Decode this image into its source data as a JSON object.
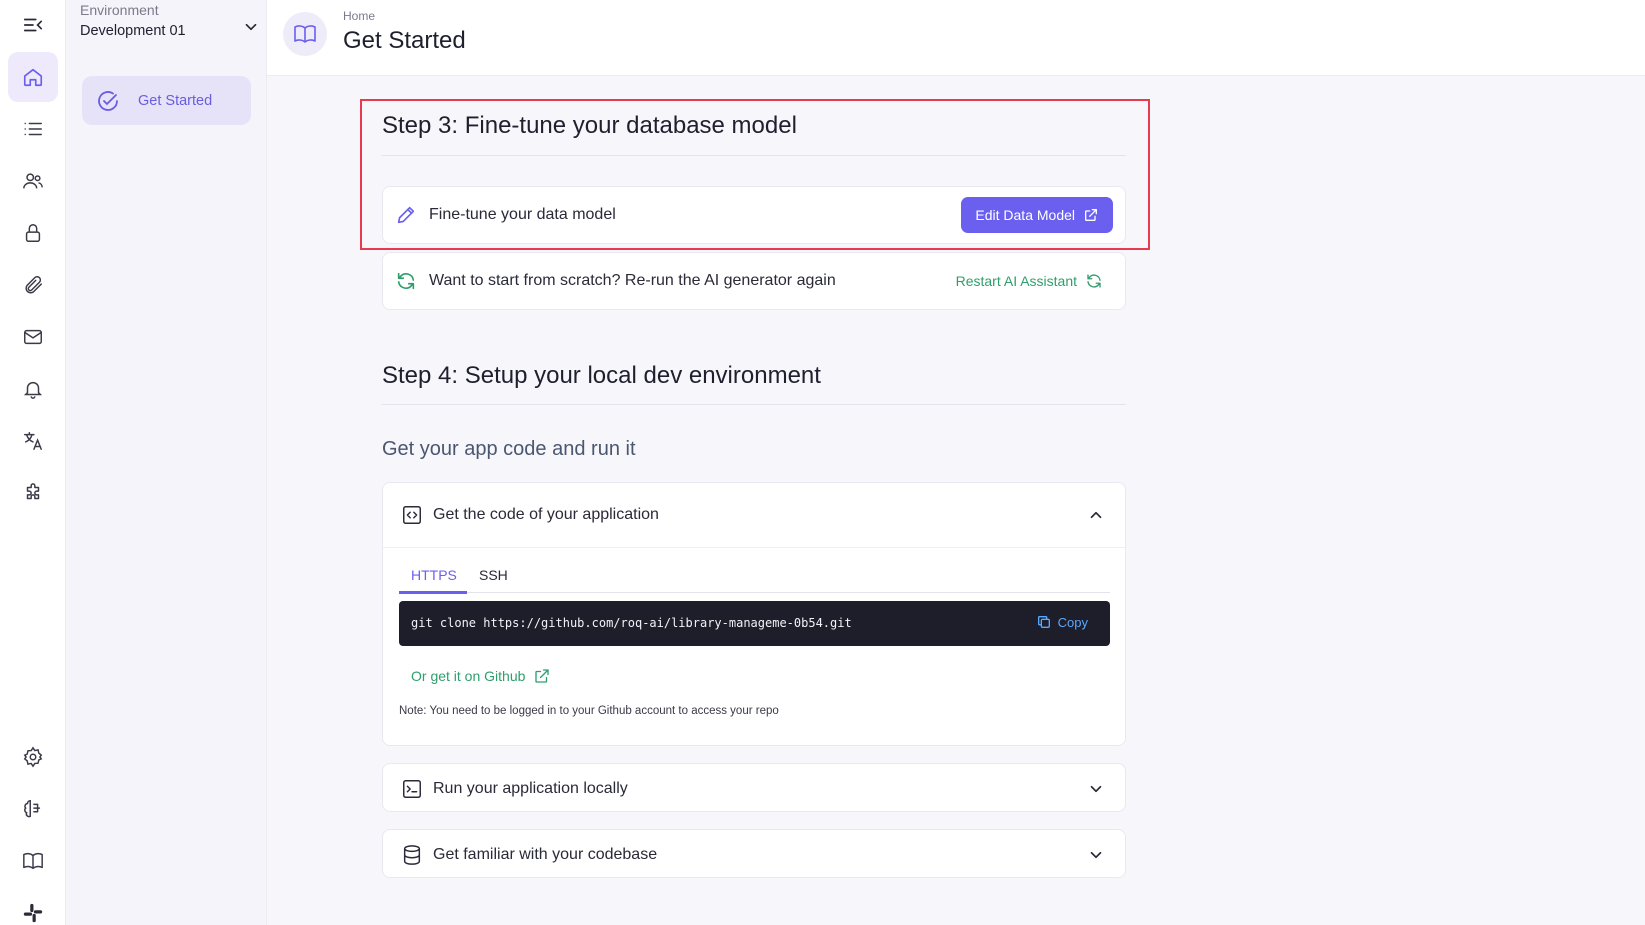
{
  "sidebar_env": {
    "label": "Environment",
    "value": "Development 01",
    "nav_active": "Get Started"
  },
  "rail": {
    "top_icons": [
      "menu-collapse-icon",
      "home-icon",
      "list-icon",
      "users-icon",
      "lock-icon",
      "paperclip-icon",
      "mail-icon",
      "bell-icon",
      "translate-icon",
      "puzzle-icon"
    ],
    "bottom_icons": [
      "gear-icon",
      "brain-icon",
      "book-icon",
      "slack-icon"
    ]
  },
  "header": {
    "breadcrumb": "Home",
    "title": "Get Started"
  },
  "step3": {
    "title": "Step 3: Fine-tune your database model",
    "finetune_text": "Fine-tune your data model",
    "edit_button": "Edit Data Model",
    "rerun_text": "Want to start from scratch? Re-run the AI generator again",
    "restart_link": "Restart AI Assistant"
  },
  "step4": {
    "title": "Step 4: Setup your local dev environment",
    "subtitle": "Get your app code and run it",
    "code_section": {
      "title": "Get the code of your application",
      "tabs": [
        "HTTPS",
        "SSH"
      ],
      "command": "git clone https://github.com/roq-ai/library-manageme-0b54.git",
      "copy_label": "Copy",
      "github_link": "Or get it on Github",
      "note": "Note: You need to be logged in to your Github account to access your repo"
    },
    "run_locally": "Run your application locally",
    "codebase": "Get familiar with your codebase"
  },
  "colors": {
    "accent": "#6b5ff0",
    "green": "#2f9e6c",
    "highlight_border": "#e53d4f",
    "code_bg": "#1d1e2a"
  }
}
